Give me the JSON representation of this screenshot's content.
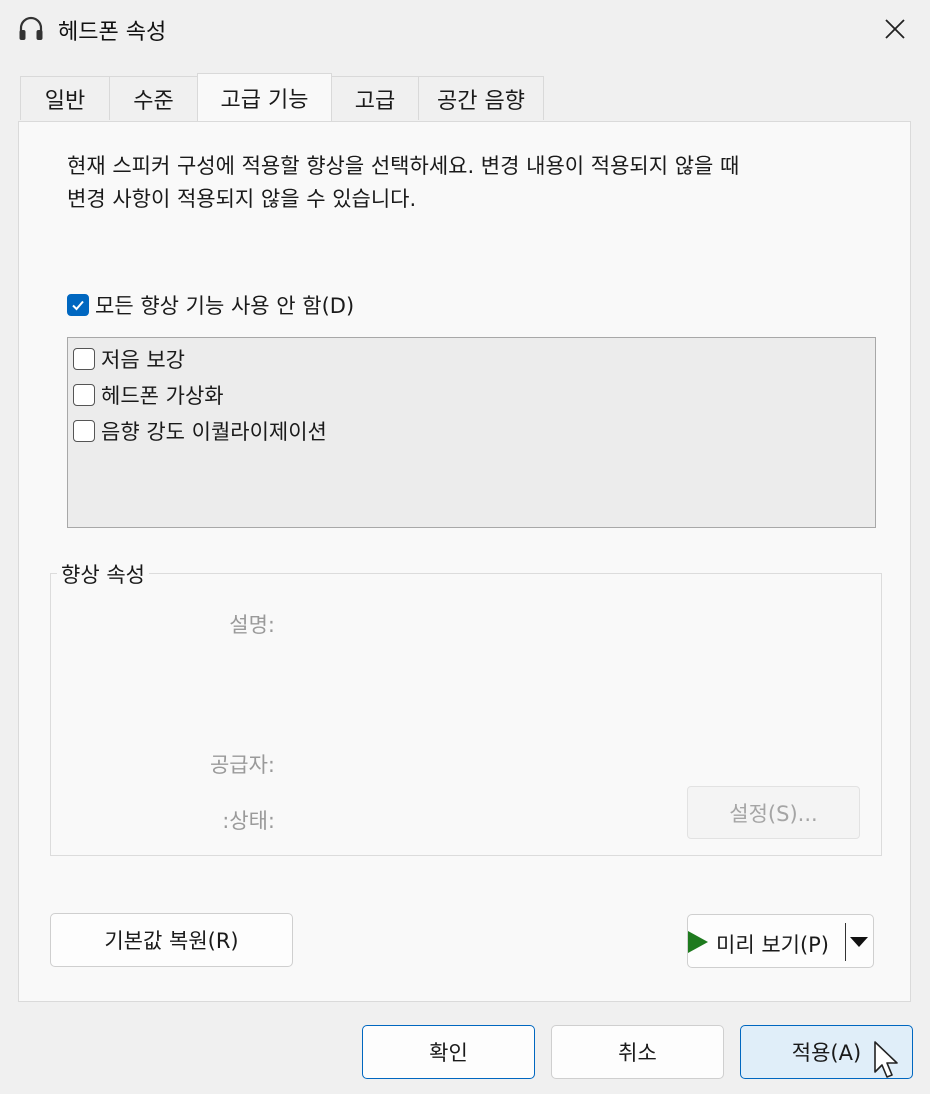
{
  "window": {
    "title": "헤드폰 속성",
    "icon": "headphones-icon",
    "close_icon": "close-icon"
  },
  "tabs": [
    {
      "label": "일반",
      "active": false
    },
    {
      "label": "수준",
      "active": false
    },
    {
      "label": "고급 기능",
      "active": true
    },
    {
      "label": "고급",
      "active": false
    },
    {
      "label": "공간 음향",
      "active": false
    }
  ],
  "panel": {
    "description_line1": "현재 스피커 구성에 적용할 향상을 선택하세요. 변경 내용이 적용되지 않을 때",
    "description_line2": "변경 사항이 적용되지 않을 수 있습니다.",
    "disable_all": {
      "label": "모든 향상 기능 사용 안 함(D)",
      "checked": true
    },
    "enhancements": [
      {
        "label": "저음 보강",
        "checked": false
      },
      {
        "label": "헤드폰 가상화",
        "checked": false
      },
      {
        "label": "음향 강도 이퀄라이제이션",
        "checked": false
      }
    ],
    "properties": {
      "group_label": "향상 속성",
      "description_label": "설명:",
      "provider_label": "공급자:",
      "status_label": ":상태:",
      "settings_button": "설정(S)..."
    },
    "restore_defaults_button": "기본값 복원(R)",
    "preview_button": "미리 보기(P)"
  },
  "footer": {
    "ok": "확인",
    "cancel": "취소",
    "apply": "적용(A)"
  },
  "colors": {
    "accent": "#0067c0",
    "play_icon": "#1e7a1e"
  }
}
